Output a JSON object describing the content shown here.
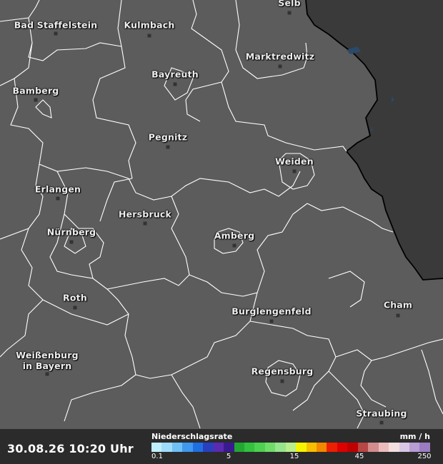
{
  "map": {
    "cities": [
      {
        "id": "selb",
        "name": "Selb"
      },
      {
        "id": "bad-staffelstein",
        "name": "Bad Staffelstein"
      },
      {
        "id": "kulmbach",
        "name": "Kulmbach"
      },
      {
        "id": "marktredwitz",
        "name": "Marktredwitz"
      },
      {
        "id": "bayreuth",
        "name": "Bayreuth"
      },
      {
        "id": "bamberg",
        "name": "Bamberg"
      },
      {
        "id": "pegnitz",
        "name": "Pegnitz"
      },
      {
        "id": "weiden",
        "name": "Weiden"
      },
      {
        "id": "erlangen",
        "name": "Erlangen"
      },
      {
        "id": "hersbruck",
        "name": "Hersbruck"
      },
      {
        "id": "nuernberg",
        "name": "Nürnberg"
      },
      {
        "id": "amberg",
        "name": "Amberg"
      },
      {
        "id": "roth",
        "name": "Roth"
      },
      {
        "id": "cham",
        "name": "Cham"
      },
      {
        "id": "burglengenfeld",
        "name": "Burglengenfeld"
      },
      {
        "id": "weissenburg",
        "name": "Weißenburg\nin Bayern"
      },
      {
        "id": "regensburg",
        "name": "Regensburg"
      },
      {
        "id": "straubing",
        "name": "Straubing"
      }
    ]
  },
  "footer": {
    "timestamp": "30.08.26 10:20 Uhr",
    "legend": {
      "title": "Niederschlagsrate",
      "unit": "mm / h",
      "ticks": [
        "0.1",
        "5",
        "15",
        "45",
        "250"
      ],
      "colors": [
        "#bff0ff",
        "#9fdcfb",
        "#6fc0f6",
        "#3f98ee",
        "#1f6fe0",
        "#2a3fc0",
        "#5a2ab0",
        "#3a1a90",
        "#22a832",
        "#33c13f",
        "#4cd150",
        "#6fdc6a",
        "#96e48c",
        "#b8ee8c",
        "#f4f400",
        "#f7be00",
        "#f28700",
        "#ee1f00",
        "#de0000",
        "#c00000",
        "#b74646",
        "#d48c8c",
        "#ecbcbc",
        "#f5dede",
        "#d8c8e6",
        "#b89cd4",
        "#9c7cc0"
      ]
    }
  }
}
